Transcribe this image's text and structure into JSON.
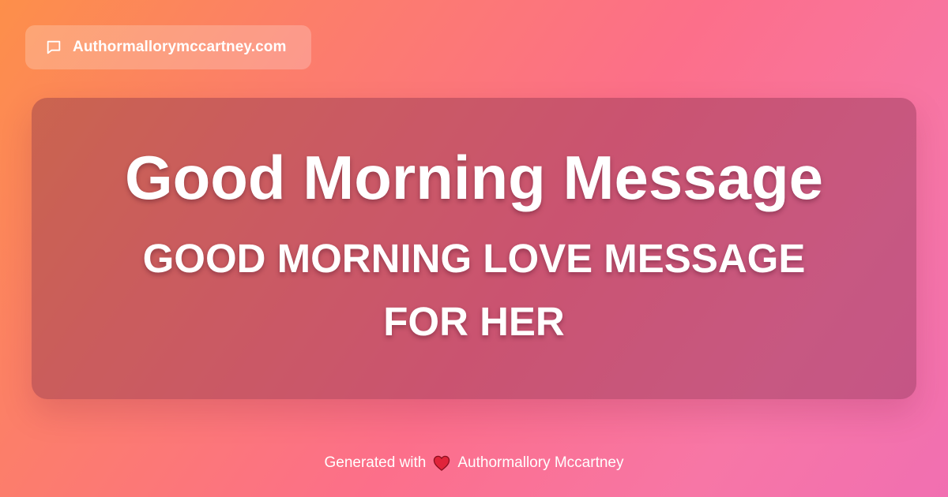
{
  "site_badge": {
    "icon": "chat-bubble-icon",
    "label": "Authormallorymccartney.com"
  },
  "card": {
    "title": "Good Morning Message",
    "subtitle": "GOOD MORNING LOVE MESSAGE FOR HER"
  },
  "footer": {
    "prefix": "Generated with",
    "heart_icon": "heart-icon",
    "author": "Authormallory Mccartney"
  },
  "colors": {
    "gradient_start": "#fd8f4a",
    "gradient_mid": "#fc6f8a",
    "gradient_end": "#f16fb1",
    "text": "#ffffff",
    "heart": "#e0243a"
  }
}
